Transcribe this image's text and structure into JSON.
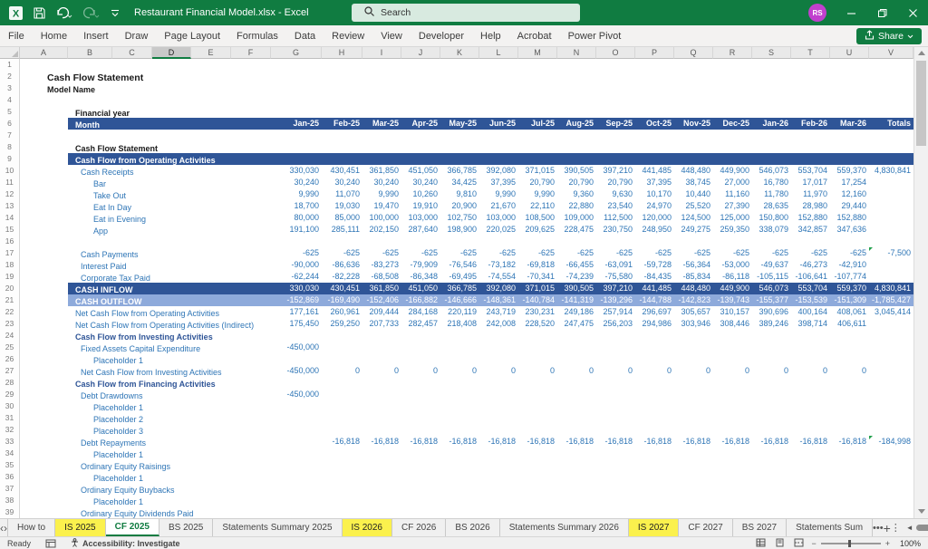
{
  "window": {
    "title": "Restaurant Financial Model.xlsx  -  Excel",
    "search_placeholder": "Search",
    "avatar_initials": "RS"
  },
  "menu": {
    "tabs": [
      "File",
      "Home",
      "Insert",
      "Draw",
      "Page Layout",
      "Formulas",
      "Data",
      "Review",
      "View",
      "Developer",
      "Help",
      "Acrobat",
      "Power Pivot"
    ],
    "share_label": "Share"
  },
  "grid": {
    "columns": [
      "A",
      "B",
      "C",
      "D",
      "E",
      "F",
      "G",
      "H",
      "I",
      "J",
      "K",
      "L",
      "M",
      "N",
      "O",
      "P",
      "Q",
      "R",
      "S",
      "T",
      "U",
      "V"
    ],
    "selected_column": "D",
    "months": [
      "Jan-25",
      "Feb-25",
      "Mar-25",
      "Apr-25",
      "May-25",
      "Jun-25",
      "Jul-25",
      "Aug-25",
      "Sep-25",
      "Oct-25",
      "Nov-25",
      "Dec-25",
      "Jan-26",
      "Feb-26",
      "Mar-26"
    ],
    "totals_label": "Totals",
    "rows": [
      {
        "t": "blank"
      },
      {
        "t": "label",
        "ind": "a",
        "sz": "big",
        "label": "Cash Flow Statement"
      },
      {
        "t": "label",
        "ind": "a",
        "label": "Model Name"
      },
      {
        "t": "blank"
      },
      {
        "t": "label",
        "ind": "h",
        "label": "Financial year"
      },
      {
        "t": "bandmonth",
        "label": "Month"
      },
      {
        "t": "blank"
      },
      {
        "t": "label",
        "ind": "h",
        "label": "Cash Flow Statement"
      },
      {
        "t": "band",
        "label": "Cash Flow from Operating Activities"
      },
      {
        "t": "data",
        "ind": "l1",
        "label": "Cash Receipts",
        "v": [
          "330,030",
          "430,451",
          "361,850",
          "451,050",
          "366,785",
          "392,080",
          "371,015",
          "390,505",
          "397,210",
          "441,485",
          "448,480",
          "449,900",
          "546,073",
          "553,704",
          "559,370",
          "4,830,841"
        ]
      },
      {
        "t": "data",
        "ind": "l2",
        "label": "Bar",
        "v": [
          "30,240",
          "30,240",
          "30,240",
          "30,240",
          "34,425",
          "37,395",
          "20,790",
          "20,790",
          "20,790",
          "37,395",
          "38,745",
          "27,000",
          "16,780",
          "17,017",
          "17,254",
          ""
        ]
      },
      {
        "t": "data",
        "ind": "l2",
        "label": "Take Out",
        "v": [
          "9,990",
          "11,070",
          "9,990",
          "10,260",
          "9,810",
          "9,990",
          "9,990",
          "9,360",
          "9,630",
          "10,170",
          "10,440",
          "11,160",
          "11,780",
          "11,970",
          "12,160",
          ""
        ]
      },
      {
        "t": "data",
        "ind": "l2",
        "label": "Eat In Day",
        "v": [
          "18,700",
          "19,030",
          "19,470",
          "19,910",
          "20,900",
          "21,670",
          "22,110",
          "22,880",
          "23,540",
          "24,970",
          "25,520",
          "27,390",
          "28,635",
          "28,980",
          "29,440",
          ""
        ]
      },
      {
        "t": "data",
        "ind": "l2",
        "label": "Eat in Evening",
        "v": [
          "80,000",
          "85,000",
          "100,000",
          "103,000",
          "102,750",
          "103,000",
          "108,500",
          "109,000",
          "112,500",
          "120,000",
          "124,500",
          "125,000",
          "150,800",
          "152,880",
          "152,880",
          ""
        ]
      },
      {
        "t": "data",
        "ind": "l2",
        "label": "App",
        "v": [
          "191,100",
          "285,111",
          "202,150",
          "287,640",
          "198,900",
          "220,025",
          "209,625",
          "228,475",
          "230,750",
          "248,950",
          "249,275",
          "259,350",
          "338,079",
          "342,857",
          "347,636",
          ""
        ]
      },
      {
        "t": "blank"
      },
      {
        "t": "data",
        "ind": "l1",
        "label": "Cash Payments",
        "m": true,
        "v": [
          "-625",
          "-625",
          "-625",
          "-625",
          "-625",
          "-625",
          "-625",
          "-625",
          "-625",
          "-625",
          "-625",
          "-625",
          "-625",
          "-625",
          "-625",
          "-7,500"
        ]
      },
      {
        "t": "data",
        "ind": "l1",
        "label": "Interest Paid",
        "v": [
          "-90,000",
          "-86,636",
          "-83,273",
          "-79,909",
          "-76,546",
          "-73,182",
          "-69,818",
          "-66,455",
          "-63,091",
          "-59,728",
          "-56,364",
          "-53,000",
          "-49,637",
          "-46,273",
          "-42,910",
          ""
        ]
      },
      {
        "t": "data",
        "ind": "l1",
        "label": "Corporate Tax Paid",
        "v": [
          "-62,244",
          "-82,228",
          "-68,508",
          "-86,348",
          "-69,495",
          "-74,554",
          "-70,341",
          "-74,239",
          "-75,580",
          "-84,435",
          "-85,834",
          "-86,118",
          "-105,115",
          "-106,641",
          "-107,774",
          ""
        ]
      },
      {
        "t": "inflow",
        "label": "CASH INFLOW",
        "v": [
          "330,030",
          "430,451",
          "361,850",
          "451,050",
          "366,785",
          "392,080",
          "371,015",
          "390,505",
          "397,210",
          "441,485",
          "448,480",
          "449,900",
          "546,073",
          "553,704",
          "559,370",
          "4,830,841"
        ]
      },
      {
        "t": "outflow",
        "label": "CASH OUTFLOW",
        "v": [
          "-152,869",
          "-169,490",
          "-152,406",
          "-166,882",
          "-146,666",
          "-148,361",
          "-140,784",
          "-141,319",
          "-139,296",
          "-144,788",
          "-142,823",
          "-139,743",
          "-155,377",
          "-153,539",
          "-151,309",
          "-1,785,427"
        ]
      },
      {
        "t": "data",
        "ind": "h",
        "label": "Net Cash Flow from Operating Activities",
        "v": [
          "177,161",
          "260,961",
          "209,444",
          "284,168",
          "220,119",
          "243,719",
          "230,231",
          "249,186",
          "257,914",
          "296,697",
          "305,657",
          "310,157",
          "390,696",
          "400,164",
          "408,061",
          "3,045,414"
        ]
      },
      {
        "t": "data",
        "ind": "h",
        "label": "Net Cash Flow from Operating Activities (Indirect)",
        "v": [
          "175,450",
          "259,250",
          "207,733",
          "282,457",
          "218,408",
          "242,008",
          "228,520",
          "247,475",
          "256,203",
          "294,986",
          "303,946",
          "308,446",
          "389,246",
          "398,714",
          "406,611",
          ""
        ]
      },
      {
        "t": "heading",
        "ind": "h",
        "label": "Cash Flow from Investing Activities"
      },
      {
        "t": "data",
        "ind": "l1",
        "label": "Fixed Assets Capital Expenditure",
        "v": [
          "-450,000",
          "",
          "",
          "",
          "",
          "",
          "",
          "",
          "",
          "",
          "",
          "",
          "",
          "",
          "",
          ""
        ]
      },
      {
        "t": "data",
        "ind": "l2",
        "label": "Placeholder 1"
      },
      {
        "t": "data",
        "ind": "l1",
        "label": "Net Cash Flow from Investing Activities",
        "v": [
          "-450,000",
          "0",
          "0",
          "0",
          "0",
          "0",
          "0",
          "0",
          "0",
          "0",
          "0",
          "0",
          "0",
          "0",
          "0",
          ""
        ]
      },
      {
        "t": "heading",
        "ind": "h",
        "label": "Cash Flow from Financing Activities"
      },
      {
        "t": "data",
        "ind": "l1",
        "label": "Debt Drawdowns",
        "v": [
          "-450,000",
          "",
          "",
          "",
          "",
          "",
          "",
          "",
          "",
          "",
          "",
          "",
          "",
          "",
          "",
          ""
        ]
      },
      {
        "t": "data",
        "ind": "l2",
        "label": "Placeholder 1"
      },
      {
        "t": "data",
        "ind": "l2",
        "label": "Placeholder 2"
      },
      {
        "t": "data",
        "ind": "l2",
        "label": "Placeholder 3"
      },
      {
        "t": "data",
        "ind": "l1",
        "label": "Debt Repayments",
        "m": true,
        "v": [
          "",
          "-16,818",
          "-16,818",
          "-16,818",
          "-16,818",
          "-16,818",
          "-16,818",
          "-16,818",
          "-16,818",
          "-16,818",
          "-16,818",
          "-16,818",
          "-16,818",
          "-16,818",
          "-16,818",
          "-184,998"
        ]
      },
      {
        "t": "data",
        "ind": "l2",
        "label": "Placeholder 1"
      },
      {
        "t": "data",
        "ind": "l1",
        "label": "Ordinary Equity Raisings"
      },
      {
        "t": "data",
        "ind": "l2",
        "label": "Placeholder 1"
      },
      {
        "t": "data",
        "ind": "l1",
        "label": "Ordinary Equity Buybacks"
      },
      {
        "t": "data",
        "ind": "l2",
        "label": "Placeholder 1"
      },
      {
        "t": "data",
        "ind": "l1",
        "label": "Ordinary Equity Dividends Paid"
      }
    ]
  },
  "sheet_tabs": {
    "tabs": [
      {
        "label": "How to",
        "state": "normal"
      },
      {
        "label": "IS 2025",
        "state": "yellow"
      },
      {
        "label": "CF 2025",
        "state": "active"
      },
      {
        "label": "BS 2025",
        "state": "normal"
      },
      {
        "label": "Statements Summary 2025",
        "state": "normal"
      },
      {
        "label": "IS 2026",
        "state": "yellow"
      },
      {
        "label": "CF 2026",
        "state": "normal"
      },
      {
        "label": "BS 2026",
        "state": "normal"
      },
      {
        "label": "Statements Summary 2026",
        "state": "normal"
      },
      {
        "label": "IS 2027",
        "state": "yellow"
      },
      {
        "label": "CF 2027",
        "state": "normal"
      },
      {
        "label": "BS 2027",
        "state": "normal"
      },
      {
        "label": "Statements Sum",
        "state": "normal"
      }
    ],
    "overflow": "•••",
    "add": "+",
    "more": "⋮"
  },
  "status": {
    "ready": "Ready",
    "accessibility": "Accessibility: Investigate",
    "zoom": "100%"
  }
}
